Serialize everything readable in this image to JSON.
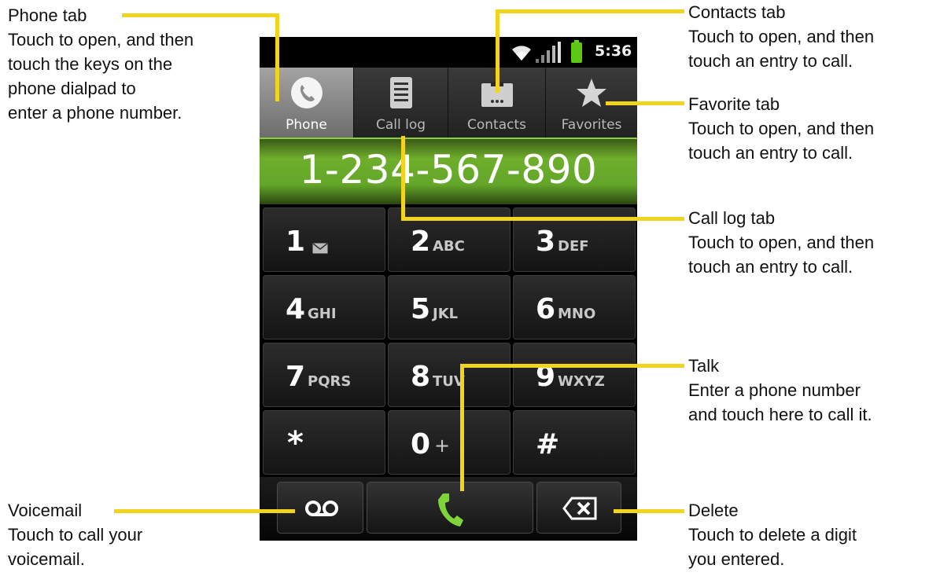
{
  "status_bar": {
    "time": "5:36"
  },
  "tabs": [
    {
      "label": "Phone",
      "icon": "phone-icon"
    },
    {
      "label": "Call log",
      "icon": "call-log-icon"
    },
    {
      "label": "Contacts",
      "icon": "contacts-icon"
    },
    {
      "label": "Favorites",
      "icon": "star-icon"
    }
  ],
  "dial_display": {
    "number": "1-234-567-890"
  },
  "keypad": [
    {
      "digit": "1",
      "letters": ""
    },
    {
      "digit": "2",
      "letters": "ABC"
    },
    {
      "digit": "3",
      "letters": "DEF"
    },
    {
      "digit": "4",
      "letters": "GHI"
    },
    {
      "digit": "5",
      "letters": "JKL"
    },
    {
      "digit": "6",
      "letters": "MNO"
    },
    {
      "digit": "7",
      "letters": "PQRS"
    },
    {
      "digit": "8",
      "letters": "TUV"
    },
    {
      "digit": "9",
      "letters": "WXYZ"
    },
    {
      "digit": "*",
      "letters": ""
    },
    {
      "digit": "0",
      "letters": "+"
    },
    {
      "digit": "#",
      "letters": ""
    }
  ],
  "bottom_buttons": {
    "voicemail_icon": "voicemail-icon",
    "talk_icon": "handset-icon",
    "delete_icon": "backspace-icon"
  },
  "callouts": {
    "phone_tab": {
      "title": "Phone tab",
      "desc": "Touch to open, and then\ntouch the keys on the\nphone dialpad to\nenter a phone number."
    },
    "contacts_tab": {
      "title": "Contacts tab",
      "desc": "Touch to open, and then\ntouch an entry to call."
    },
    "favorite_tab": {
      "title": "Favorite tab",
      "desc": "Touch to open, and then\ntouch an entry to call."
    },
    "call_log_tab": {
      "title": "Call log tab",
      "desc": "Touch to open, and then\ntouch an entry to call."
    },
    "talk": {
      "title": "Talk",
      "desc": "Enter a phone number\nand touch here to call it."
    },
    "voicemail": {
      "title": "Voicemail",
      "desc": "Touch to call your\nvoicemail."
    },
    "delete": {
      "title": "Delete",
      "desc": "Touch to delete a digit\nyou entered."
    }
  },
  "colors": {
    "leader_line": "#f2d41e",
    "number_bar": "#63a629",
    "talk_icon": "#7fd43a"
  }
}
